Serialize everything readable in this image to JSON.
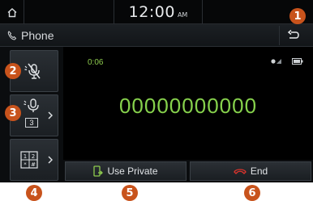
{
  "status_bar": {
    "time": "12:00",
    "ampm": "AM"
  },
  "title_bar": {
    "title": "Phone"
  },
  "call": {
    "duration": "0:06",
    "number": "00000000000"
  },
  "side_buttons": {
    "mute_icon": "microphone-muted-icon",
    "volume_icon": "microphone-volume-icon",
    "volume_level": "3",
    "keypad_icon": "keypad-icon"
  },
  "actions": {
    "use_private": "Use Private",
    "end": "End"
  },
  "callouts": [
    "1",
    "2",
    "3",
    "4",
    "5",
    "6"
  ],
  "colors": {
    "accent_green": "#86d14c",
    "end_red": "#e0342c",
    "callout": "#c8531c"
  }
}
